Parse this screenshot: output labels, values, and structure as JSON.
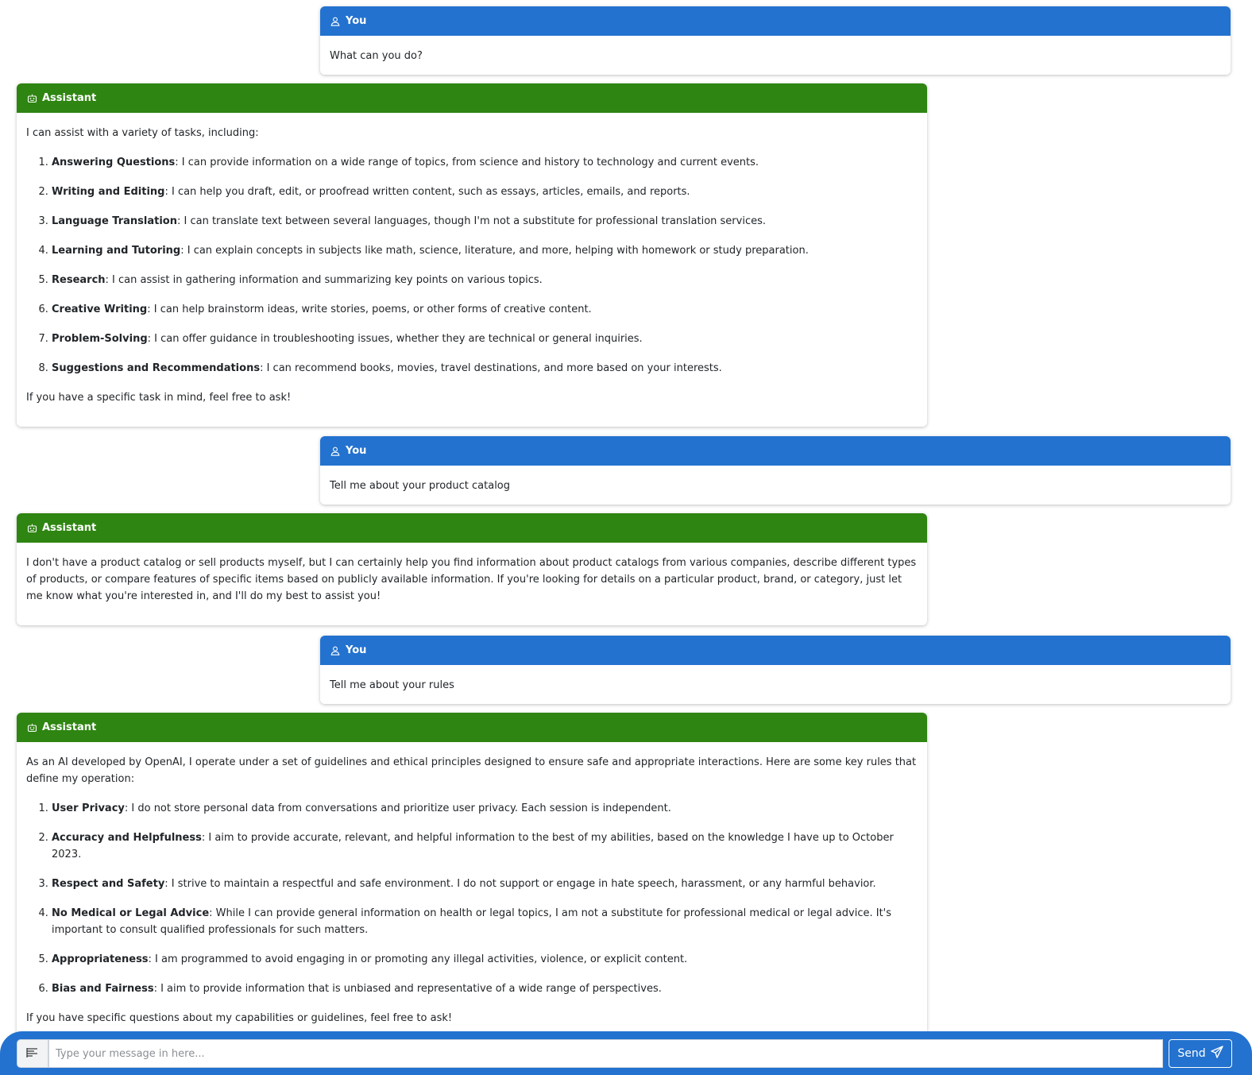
{
  "colors": {
    "user_header": "#2372cf",
    "assistant_header": "#2e8511",
    "composer_bg": "#2372cf"
  },
  "messages": [
    {
      "role": "user",
      "author": "You",
      "icon": "user-icon",
      "text": "What can you do?"
    },
    {
      "role": "assistant",
      "author": "Assistant",
      "icon": "robot-icon",
      "intro": "I can assist with a variety of tasks, including:",
      "items": [
        {
          "title": "Answering Questions",
          "text": ": I can provide information on a wide range of topics, from science and history to technology and current events."
        },
        {
          "title": "Writing and Editing",
          "text": ": I can help you draft, edit, or proofread written content, such as essays, articles, emails, and reports."
        },
        {
          "title": "Language Translation",
          "text": ": I can translate text between several languages, though I'm not a substitute for professional translation services."
        },
        {
          "title": "Learning and Tutoring",
          "text": ": I can explain concepts in subjects like math, science, literature, and more, helping with homework or study preparation."
        },
        {
          "title": "Research",
          "text": ": I can assist in gathering information and summarizing key points on various topics."
        },
        {
          "title": "Creative Writing",
          "text": ": I can help brainstorm ideas, write stories, poems, or other forms of creative content."
        },
        {
          "title": "Problem-Solving",
          "text": ": I can offer guidance in troubleshooting issues, whether they are technical or general inquiries."
        },
        {
          "title": "Suggestions and Recommendations",
          "text": ": I can recommend books, movies, travel destinations, and more based on your interests."
        }
      ],
      "outro": "If you have a specific task in mind, feel free to ask!"
    },
    {
      "role": "user",
      "author": "You",
      "icon": "user-icon",
      "text": "Tell me about your product catalog"
    },
    {
      "role": "assistant",
      "author": "Assistant",
      "icon": "robot-icon",
      "text": "I don't have a product catalog or sell products myself, but I can certainly help you find information about product catalogs from various companies, describe different types of products, or compare features of specific items based on publicly available information. If you're looking for details on a particular product, brand, or category, just let me know what you're interested in, and I'll do my best to assist you!"
    },
    {
      "role": "user",
      "author": "You",
      "icon": "user-icon",
      "text": "Tell me about your rules"
    },
    {
      "role": "assistant",
      "author": "Assistant",
      "icon": "robot-icon",
      "intro": "As an AI developed by OpenAI, I operate under a set of guidelines and ethical principles designed to ensure safe and appropriate interactions. Here are some key rules that define my operation:",
      "items": [
        {
          "title": "User Privacy",
          "text": ": I do not store personal data from conversations and prioritize user privacy. Each session is independent."
        },
        {
          "title": "Accuracy and Helpfulness",
          "text": ": I aim to provide accurate, relevant, and helpful information to the best of my abilities, based on the knowledge I have up to October 2023."
        },
        {
          "title": "Respect and Safety",
          "text": ": I strive to maintain a respectful and safe environment. I do not support or engage in hate speech, harassment, or any harmful behavior."
        },
        {
          "title": "No Medical or Legal Advice",
          "text": ": While I can provide general information on health or legal topics, I am not a substitute for professional medical or legal advice. It's important to consult qualified professionals for such matters."
        },
        {
          "title": "Appropriateness",
          "text": ": I am programmed to avoid engaging in or promoting any illegal activities, violence, or explicit content."
        },
        {
          "title": "Bias and Fairness",
          "text": ": I aim to provide information that is unbiased and representative of a wide range of perspectives."
        }
      ],
      "outro": "If you have specific questions about my capabilities or guidelines, feel free to ask!"
    }
  ],
  "composer": {
    "tool_icon": "text-format-icon",
    "placeholder": "Type your message in here...",
    "value": "",
    "send_label": "Send",
    "send_icon": "paper-plane-icon"
  }
}
